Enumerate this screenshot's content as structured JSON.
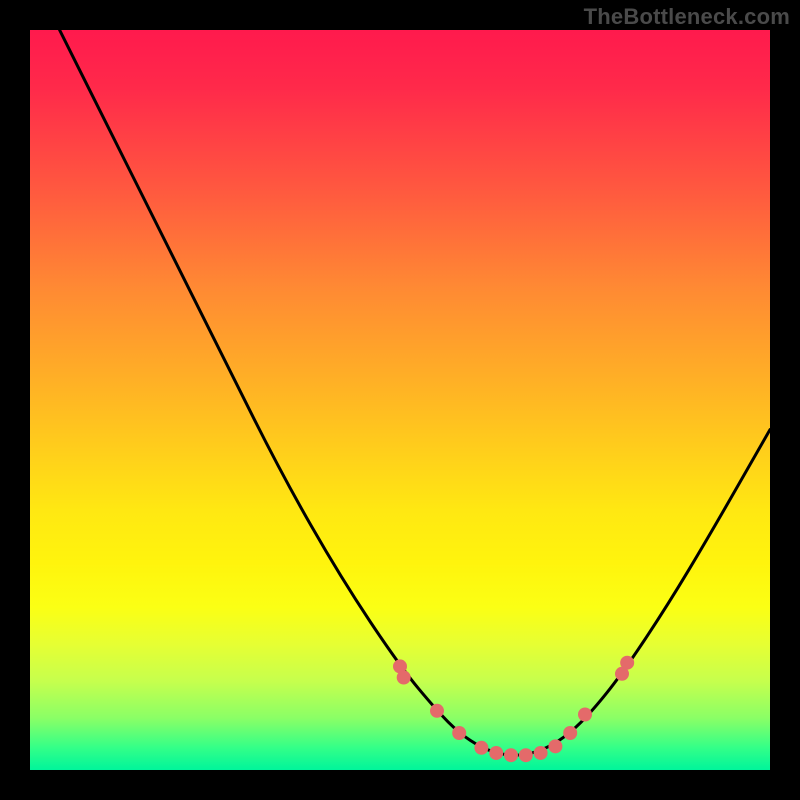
{
  "watermark": "TheBottleneck.com",
  "chart_data": {
    "type": "line",
    "title": "",
    "xlabel": "",
    "ylabel": "",
    "xlim": [
      0,
      100
    ],
    "ylim": [
      0,
      100
    ],
    "curve": {
      "name": "bottleneck-curve",
      "x": [
        4,
        10,
        18,
        26,
        34,
        42,
        50,
        55,
        58,
        61,
        64,
        67,
        70,
        73,
        76,
        80,
        86,
        92,
        100
      ],
      "y": [
        100,
        88,
        72,
        56,
        40,
        26,
        14,
        8,
        5,
        3,
        2,
        2,
        3,
        5,
        8,
        13,
        22,
        32,
        46
      ]
    },
    "markers": {
      "name": "highlight-dots",
      "color": "#e46a6a",
      "x": [
        50,
        50.5,
        55,
        58,
        61,
        63,
        65,
        67,
        69,
        71,
        73,
        75,
        80,
        80.7
      ],
      "y": [
        14,
        12.5,
        8,
        5,
        3,
        2.3,
        2,
        2,
        2.3,
        3.2,
        5,
        7.5,
        13,
        14.5
      ]
    }
  }
}
